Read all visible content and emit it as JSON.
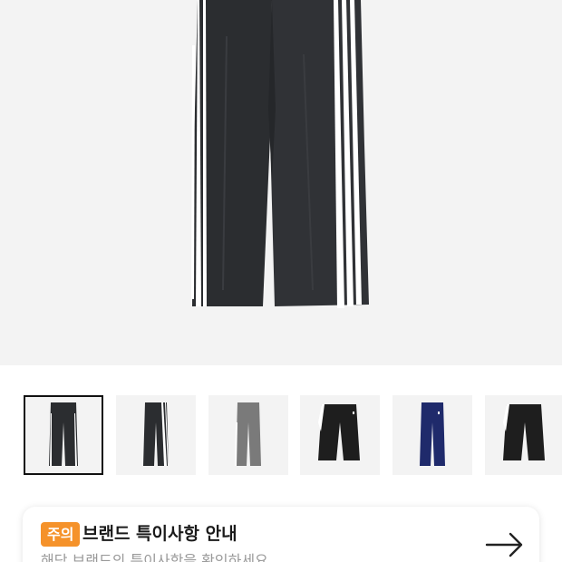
{
  "product": {
    "main_image": "track-pants-black-3-stripes",
    "thumbnails": [
      {
        "name": "thumb-black-front",
        "colors": {
          "fabric": "#2b2d30",
          "stripe": "#ffffff"
        },
        "selected": true
      },
      {
        "name": "thumb-black-side",
        "colors": {
          "fabric": "#2b2d30",
          "stripe": "#ffffff"
        },
        "selected": false
      },
      {
        "name": "thumb-grey",
        "colors": {
          "fabric": "#7a7a7a",
          "stripe": "#ffffff"
        },
        "selected": false
      },
      {
        "name": "thumb-black-cropped",
        "colors": {
          "fabric": "#1e1e1e",
          "stripe": "#ffffff"
        },
        "selected": false
      },
      {
        "name": "thumb-navy",
        "colors": {
          "fabric": "#1f2a6b",
          "stripe": "#1f2a6b"
        },
        "selected": false
      },
      {
        "name": "thumb-black-cropped-2",
        "colors": {
          "fabric": "#1e1e1e",
          "stripe": "#ffffff"
        },
        "selected": false
      }
    ]
  },
  "notice": {
    "badge": "주의",
    "title": "브랜드 특이사항 안내",
    "subtitle": "해당 브랜드의 특이사항을 확인하세요",
    "arrow_icon": "arrow-right-icon"
  },
  "colors": {
    "badge": "#f5922a",
    "hero_background": "#f3f3f3"
  }
}
